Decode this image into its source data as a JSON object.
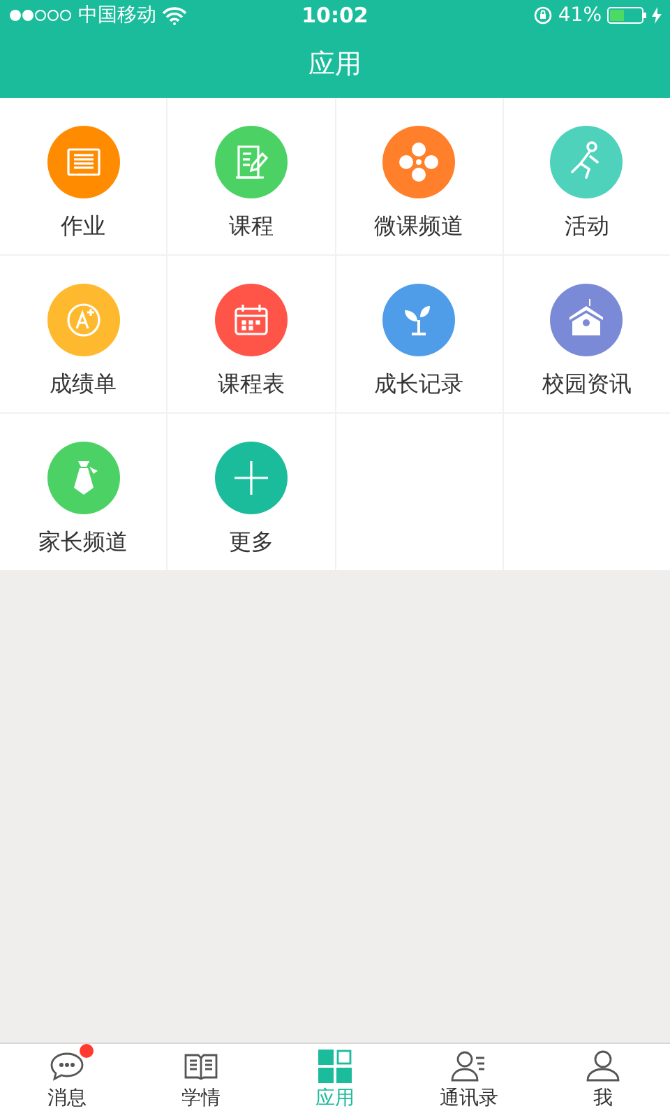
{
  "status_bar": {
    "carrier": "中国移动",
    "time": "10:02",
    "battery": "41%"
  },
  "header": {
    "title": "应用"
  },
  "apps": [
    {
      "label": "作业",
      "kind": "list",
      "color": "#ff8c00"
    },
    {
      "label": "课程",
      "kind": "note",
      "color": "#4cd264"
    },
    {
      "label": "微课频道",
      "kind": "flower",
      "color": "#ff7f2a"
    },
    {
      "label": "活动",
      "kind": "runner",
      "color": "#4ed2bc"
    },
    {
      "label": "成绩单",
      "kind": "grade",
      "color": "#ffb92e"
    },
    {
      "label": "课程表",
      "kind": "calendar",
      "color": "#ff5548"
    },
    {
      "label": "成长记录",
      "kind": "sprout",
      "color": "#4f9de8"
    },
    {
      "label": "校园资讯",
      "kind": "school",
      "color": "#7a8ad6"
    },
    {
      "label": "家长频道",
      "kind": "tie",
      "color": "#4cd264"
    },
    {
      "label": "更多",
      "kind": "plus",
      "color": "#1bbc9b"
    }
  ],
  "tabs": [
    {
      "label": "消息",
      "kind": "chat",
      "selected": false,
      "badge": true
    },
    {
      "label": "学情",
      "kind": "book",
      "selected": false,
      "badge": false
    },
    {
      "label": "应用",
      "kind": "grid",
      "selected": true,
      "badge": false
    },
    {
      "label": "通讯录",
      "kind": "contacts",
      "selected": false,
      "badge": false
    },
    {
      "label": "我",
      "kind": "person",
      "selected": false,
      "badge": false
    }
  ]
}
